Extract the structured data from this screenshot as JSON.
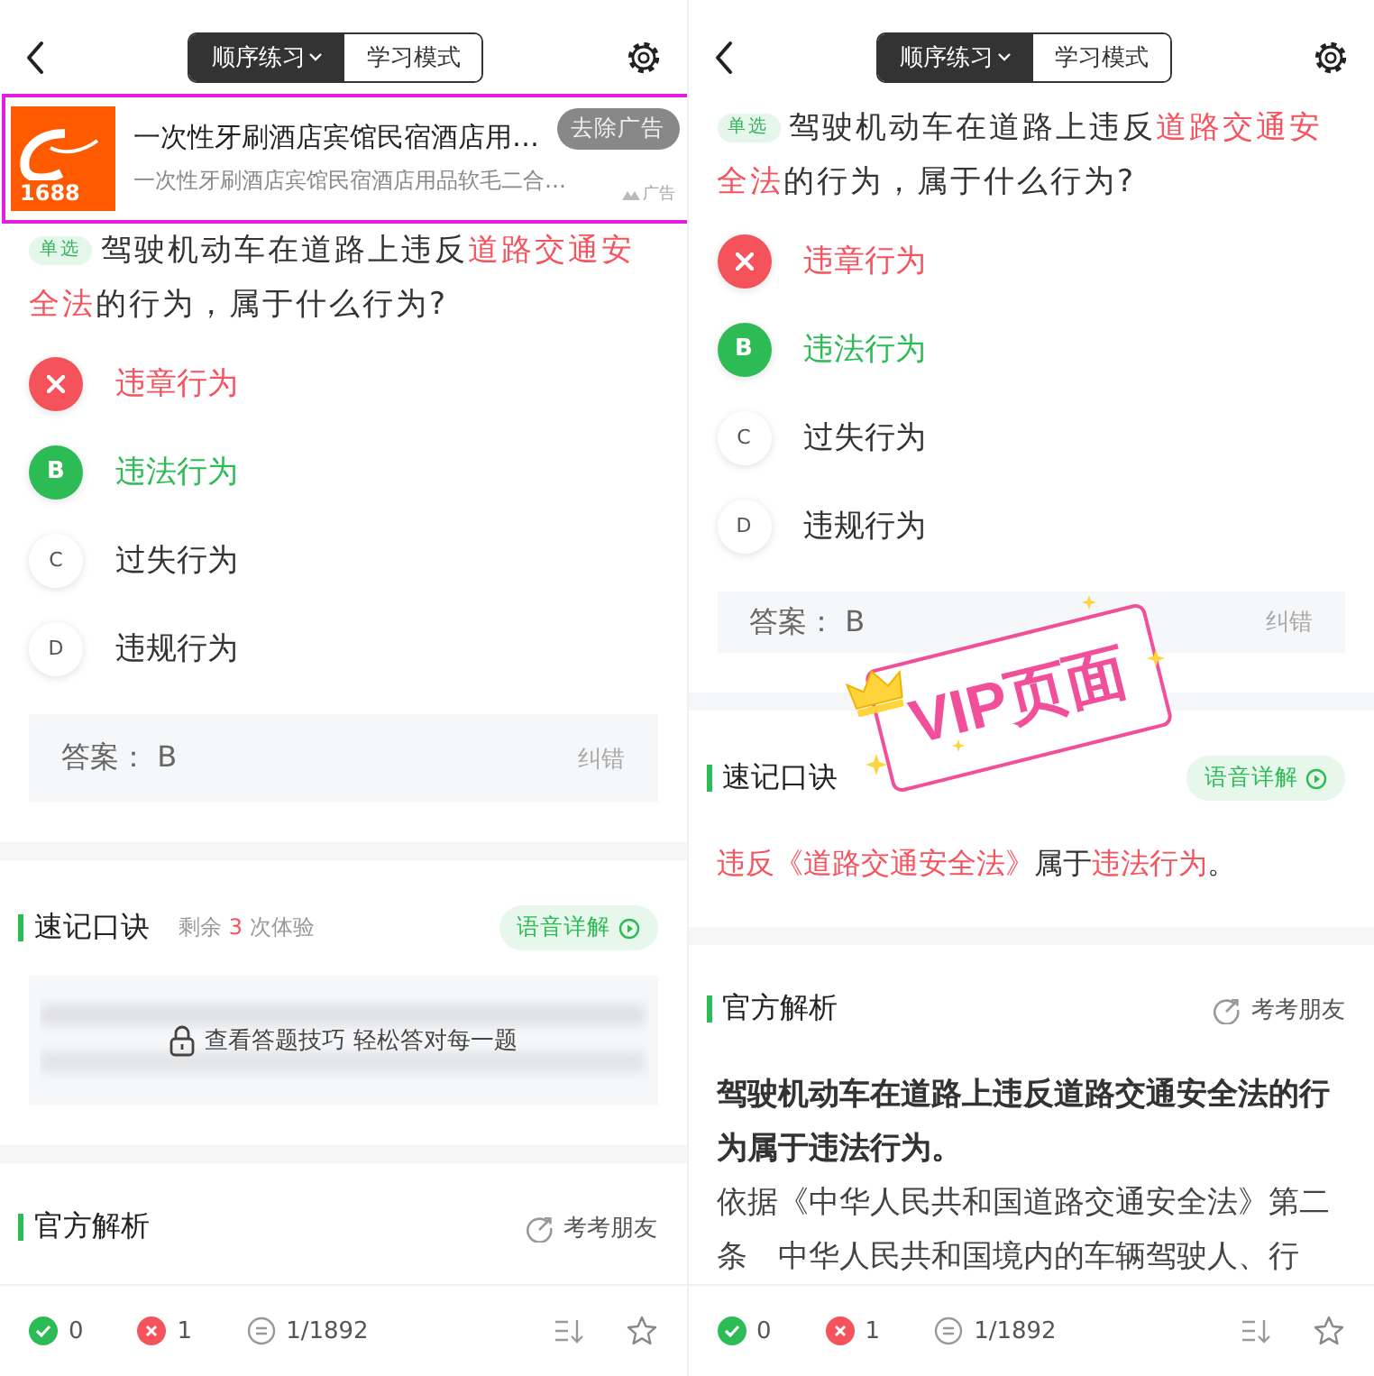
{
  "panels": [
    {
      "nav": {
        "tabs": [
          {
            "label": "顺序练习",
            "selected": true,
            "dropdown": true
          },
          {
            "label": "学习模式",
            "selected": false,
            "dropdown": false
          }
        ]
      },
      "ad": {
        "highlighted": true,
        "logo_text": "1688",
        "title": "一次性牙刷酒店宾馆民宿酒店用…",
        "subtitle": "一次性牙刷酒店宾馆民宿酒店用品软毛二合…",
        "remove_label": "去除广告",
        "tag": "广告"
      },
      "question": {
        "tag": "单选",
        "segments": [
          {
            "text": "驾驶机动车在道路上违反",
            "highlight": false
          },
          {
            "text": "道路交通安全法",
            "highlight": true
          },
          {
            "text": "的行为，属于什么行为?",
            "highlight": false
          }
        ]
      },
      "options": [
        {
          "kind": "wrong",
          "text": "违章行为"
        },
        {
          "kind": "correct",
          "marker": "B",
          "text": "违法行为"
        },
        {
          "kind": "plain",
          "marker": "C",
          "text": "过失行为"
        },
        {
          "kind": "plain",
          "marker": "D",
          "text": "违规行为"
        }
      ],
      "answer": {
        "text": "答案： B",
        "correction": "纠错"
      },
      "mnemonic": {
        "title": "速记口诀",
        "trial": [
          {
            "text": "剩余 ",
            "highlight": false
          },
          {
            "text": "3",
            "highlight": true
          },
          {
            "text": " 次体验",
            "highlight": false
          }
        ],
        "voice_button": "语音详解",
        "locked": true,
        "lock_message": "查看答题技巧 轻松答对每一题"
      },
      "analysis": {
        "title": "官方解析",
        "share": "考考朋友"
      },
      "bottom_bar": {
        "correct": "0",
        "wrong": "1",
        "progress": "1/1892"
      }
    },
    {
      "nav": {
        "tabs": [
          {
            "label": "顺序练习",
            "selected": true,
            "dropdown": true
          },
          {
            "label": "学习模式",
            "selected": false,
            "dropdown": false
          }
        ]
      },
      "question": {
        "tag": "单选",
        "segments": [
          {
            "text": "驾驶机动车在道路上违反",
            "highlight": false
          },
          {
            "text": "道路交通安全法",
            "highlight": true
          },
          {
            "text": "的行为，属于什么行为?",
            "highlight": false
          }
        ]
      },
      "options": [
        {
          "kind": "wrong",
          "text": "违章行为"
        },
        {
          "kind": "correct",
          "marker": "B",
          "text": "违法行为"
        },
        {
          "kind": "plain",
          "marker": "C",
          "text": "过失行为"
        },
        {
          "kind": "plain",
          "marker": "D",
          "text": "违规行为"
        }
      ],
      "answer": {
        "text": "答案： B",
        "correction": "纠错"
      },
      "mnemonic": {
        "title": "速记口诀",
        "voice_button": "语音详解",
        "locked": false,
        "segments": [
          {
            "text": "违反《道路交通安全法》",
            "highlight": true
          },
          {
            "text": "属于",
            "highlight": false
          },
          {
            "text": "违法行为",
            "highlight": true
          },
          {
            "text": "。",
            "highlight": false
          }
        ]
      },
      "analysis": {
        "title": "官方解析",
        "share": "考考朋友",
        "summary": "驾驶机动车在道路上违反道路交通安全法的行为属于违法行为。",
        "body": "依据《中华人民共和国道路交通安全法》第二条　中华人民共和国境内的车辆驾驶人、行"
      },
      "bottom_bar": {
        "correct": "0",
        "wrong": "1",
        "progress": "1/1892"
      },
      "vip_stamp": {
        "text": "VIP页面"
      }
    }
  ]
}
